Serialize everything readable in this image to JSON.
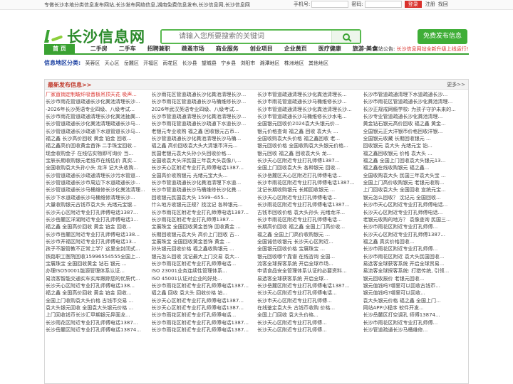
{
  "topbar": {
    "slogan": "专做长沙本地分类信息发布网站,长沙发布网络信息,湖南免费信息发布,长沙信息网,长沙信息网",
    "username_label": "手机号:",
    "password_label": "密码:",
    "login_label": "登录",
    "register_label": "注册",
    "forgot_label": "找回"
  },
  "header": {
    "logo_text": "长沙信息网",
    "search_placeholder": "请输入您所要搜索的关键词",
    "post_button": "免费发布信息"
  },
  "nav": {
    "items": [
      "首 页",
      "二手房",
      "二手车",
      "招聘兼职",
      "跳蚤市场",
      "商业服务",
      "创业项目",
      "企业黄页",
      "医疗健康",
      "旅游·美食"
    ],
    "notice_label": "网站公告:",
    "notice_text": "长沙信息网站全新升级上线运行! 欢迎"
  },
  "regions": {
    "title": "信息地区分类:",
    "items": [
      "芙蓉区",
      "天心区",
      "岳麓区",
      "开福区",
      "雨花区",
      "长沙县",
      "望城县",
      "宁乡县",
      "浏阳市",
      "湘潭地区",
      "株洲地区",
      "其他地区"
    ]
  },
  "panel": {
    "title": "最新发布信息>>",
    "more": "更多>>",
    "columns": [
      [
        "厂家直销定制玻纤吸音板吊顶天花 吸声...",
        "长沙市雨花管道疏通长沙化粪池清理长沙...",
        "-2026年长沙英语专业四级、八级考试...",
        "长沙市雨花管道疏通清理长沙化粪池抽粪...",
        "长沙管道疏通长沙化粪池清理疏通长沙马...",
        "长沙管道疏通长沙疏通下水道管道长沙马...",
        "福之鑫 长沙高价回收 黄金 铂金 回收...",
        "福之鑫高价回收黄金首饰 二手珠宝回收...",
        "现金收购金子 在线估实物即可询价 当...",
        "宝辰长期收购银元老纸币在线估价 真实...",
        "全国收购袁大头孙小头 龙洋 记大头收购...",
        "长沙管道疏通长沙疏通清理长沙污水管道...",
        "长沙管道疏通长沙市周边下水道疏通长沙...",
        "长沙管道疏通长沙马桶维修长沙化粪池清理...",
        "长沙下水道疏通长沙马桶维修清理长沙...",
        "大量收购银元古钱币袁大头 光绪元宝银...",
        "长沙天心区附近专业打孔师傅电话1387...",
        "长沙岳麓区洋湖附近专业打孔师傅电话1...",
        "福之鑫 全国高价回收 黄金 铂金 回收...",
        "长沙市岳麓区附近专业打孔师傅电话138...",
        "长沙市开福区附近专业打孔师傅电话13...",
        "孩子不服管教不正常上学？这里全封闭式...",
        "铁路职工医院回收15996554555全国上...",
        "宝展珠宝 全国回收黄金 钻石 银元 ...",
        "办理ISO50001能源管理体系认证...",
        "易流客智能交通实车实库跟踪您的优质代...",
        "长沙天心区附近专业打孔师傅电话138...",
        "福之鑫 全国高价回收 黄金 铂金 回收...",
        "全国上门收购袁大头价格 古钱币交易 ...",
        "袁大头银元回收 全国袁大头银元价格 ...",
        "上门回收钱币长沙汇甲期银元异面龙...",
        "长沙雨花区附近专业打孔师傅电话1387...",
        "长沙岳麓区附近专业打孔师傅电话13874..."
      ],
      [
        "长沙雨花区管道疏通长沙化粪池清理长沙...",
        "长沙市雨花区管道疏通长沙马桶维修长沙...",
        "2026年武汉英语专业四级、八级考试...",
        "长沙市管道疏通清理长沙化粪池清理长沙...",
        "长沙市雨花管道疏通长沙疏通下水道长沙...",
        "老银元专业收购 福之鑫 回收银元古币...",
        "长沙管道疏通长沙化粪池清理长沙马桶...",
        "福之鑫 高价回收袁大头大清银币洋元...",
        "民国老银元袁大头孙小头回收价格...",
        "全国收袁大头洋民国三年袁大头袁像八...",
        "长沙天心区附近专业打孔师傅电话1387...",
        "全国高价收购银元 光绪元宝大头...",
        "长沙市管道疏通长沙化粪池清理下水道...",
        "长沙市管道疏通长沙马桶维修长沙化粪...",
        "回收银元民国袁大头 1599--655...",
        "什么地方收银元正规？找沈记 各种银元...",
        "长沙市雨花区附近专业打孔师傅电话1387...",
        "长沙雨花区附近专业打孔师傅1387...",
        "宝展珠宝 全国回收黄金首饰 回收黄金 ...",
        "长期回收银元袁大头 高价上门回收 古...",
        "宝展珠宝 全国回收黄金首饰 黄金 ...",
        "孙头银元回收价格 福之鑫收购银元 ...",
        "银元怎么回收 沈记最大上门交易 袁大...",
        "长沙市雨花区附近专业打孔师傅电话...",
        "ISO 23001业务连续性管理体系...",
        "ISO 45001认证对企业的好处...",
        "长沙市雨花区附近专业打孔师傅电话1387...",
        "福之鑫 回收 袁大头 回收价格 铂...",
        "长沙天心区附近专业打孔师傅电话1387...",
        "长沙天心区附近专业打孔师傅电话1387...",
        "长沙市雨花区附近专业打孔师傅电话...",
        "长沙市雨花区附近专业打孔师傅电话1387...",
        "长沙市雨花区附近专业打孔师傅电话1387..."
      ],
      [
        "长沙市管道疏通清理长沙化粪池清理长...",
        "长沙市雨花管道疏通长沙马桶维修长沙...",
        "长沙市管道疏通清理长沙化粪池清理长沙...",
        "长沙市管道疏通长沙马桶维修长沙水电...",
        "全国银元回收价2024袁大头银元价...",
        "银元价格查询 福之鑫 回收 袁大头 ...",
        "全国收购袁大头价格 福之鑫回收 老...",
        "银元回收价格 全国收购袁大头银元价格...",
        "银元回收 福之鑫 回收袁大头 龙...",
        "长沙天心区附近专业打孔师傅1387...",
        "全国上门回收袁大头 各种银元 回收...",
        "长沙岳麓区天心区附近打孔师傅电话...",
        "长沙市雨花区附近专业打孔师傅电话1387...",
        "沈记长期收购银元 长期回收银元 ...",
        "长沙天心区附近专业打孔师傅电话...",
        "长沙雨花区附近专业打孔师傅电话1387...",
        "古钱币回收价格 袁大头孙头 光绪龙洋...",
        "长沙市雨花区附近专业打孔师傅电话...",
        "长期高价回收 福之鑫 全国上门高价收...",
        "福之鑫 全国上门高价收购银元 ...",
        "全国诚信收银元 长沙天心区附近...",
        "全国银元回收价格 宝展珠宝 ...",
        "银元回收哪个靠谱 在线咨询 全国...",
        "流客全球探客系统 开启全球市场...",
        "申请食品安全管理体系认证的必要资料...",
        "易选客全球获客系统 开启全球...",
        "长沙岳麓区附近专业打孔师傅电话1387...",
        "长沙天心区附近专业打孔师傅电话...",
        "长沙市天心区附近专业打孔师傅...",
        "在线鉴定袁大头 古钱币收购 价格...",
        "全国上门回收 袁大头价格...",
        "长沙天心区附近专业打孔师傅...",
        "长沙天心区附近专业打孔师傅..."
      ],
      [
        "长沙市管道疏通清理下水道疏通长沙...",
        "长沙市雨花区管道疏通长沙化粪池清理...",
        "长沙正规戒网瘾学校: 为孩子守护未来的...",
        "长沙专业管道疏通长沙化粪池清理...",
        "黄金钻石银元高价回收 福之鑫 黄金...",
        "全国银元正大洋银币价格回收洋银...",
        "全国银元收藏 长期回收银元 ...",
        "回收银元 袁大头 光绪元宝 铂...",
        "福之鑫回收银元 价格 袁大头 ...",
        "福之鑫 全国上门回收袁大头银元13...",
        "福之鑫在线收购银元 福之鑫...",
        "全国收购袁大头 民国三年袁大头宝 ...",
        "全国上门高价收购银元 老银元收购...",
        "上门回收袁大头 全国回收 宣统元宝...",
        "银元怎么回收？ 沈记元 全国回收...",
        "长沙市天心区附近专业打孔师傅电话...",
        "长沙天心区附近专业打孔师傅电话...",
        "老银元收购的地方？ 袁像查询 民国三...",
        "长沙市雨花区附近专业打孔师傅...",
        "长沙天心区附近专业打孔师傅1387...",
        "福之鑫 真实价格回收...",
        "长沙市雨花区附近专业打孔师傅...",
        "长沙市雨花区附近 袁大头民国回收...",
        "易选客全球获客系统 开启全球贸易...",
        "易流客全球探客系统: 打猎传统, 引领...",
        "银元回收报价 老银元回收...",
        "银元值钱吗?哪里可以回收古钱币...",
        "银元值钱吗?哪里可以回收...",
        "袁大头银元价格 福之鑫 全国上门...",
        "网站APP小程序 软件开发...",
        "长沙岳麓区打空调孔 师傅13874...",
        "长沙市雨花区附近专业打孔师傅...",
        "长沙管道疏通长沙马桶维修..."
      ]
    ]
  }
}
